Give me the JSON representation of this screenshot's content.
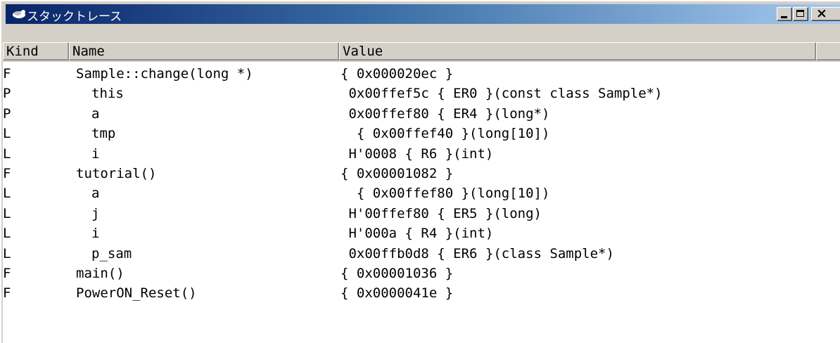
{
  "window": {
    "title": "スタックトレース",
    "icon": "stack-trace-app-icon",
    "minimize_glyph": "minimize-icon",
    "maximize_glyph": "maximize-icon",
    "close_label": "×",
    "colors": {
      "titlebar_start": "#0a246a",
      "titlebar_end": "#a6caf0",
      "face": "#d4d0c8"
    }
  },
  "columns": {
    "kind": "Kind",
    "name": "Name",
    "value": "Value"
  },
  "rows": [
    {
      "kind": "F",
      "name": "Sample::change(long *)",
      "value": "{ 0x000020ec }",
      "indent": 0
    },
    {
      "kind": "P",
      "name": "this",
      "value": " 0x00ffef5c { ER0 }(const class Sample*)",
      "indent": 1
    },
    {
      "kind": "P",
      "name": "a",
      "value": " 0x00ffef80 { ER4 }(long*)",
      "indent": 1
    },
    {
      "kind": "L",
      "name": "tmp",
      "value": "  { 0x00ffef40 }(long[10])",
      "indent": 1
    },
    {
      "kind": "L",
      "name": "i",
      "value": " H'0008 { R6 }(int)",
      "indent": 1
    },
    {
      "kind": "F",
      "name": "tutorial()",
      "value": "{ 0x00001082 }",
      "indent": 0
    },
    {
      "kind": "L",
      "name": "a",
      "value": "  { 0x00ffef80 }(long[10])",
      "indent": 1
    },
    {
      "kind": "L",
      "name": "j",
      "value": " H'00ffef80 { ER5 }(long)",
      "indent": 1
    },
    {
      "kind": "L",
      "name": "i",
      "value": " H'000a { R4 }(int)",
      "indent": 1
    },
    {
      "kind": "L",
      "name": "p_sam",
      "value": " 0x00ffb0d8 { ER6 }(class Sample*)",
      "indent": 1
    },
    {
      "kind": "F",
      "name": "main()",
      "value": "{ 0x00001036 }",
      "indent": 0
    },
    {
      "kind": "F",
      "name": "PowerON_Reset()",
      "value": "{ 0x0000041e }",
      "indent": 0
    }
  ]
}
